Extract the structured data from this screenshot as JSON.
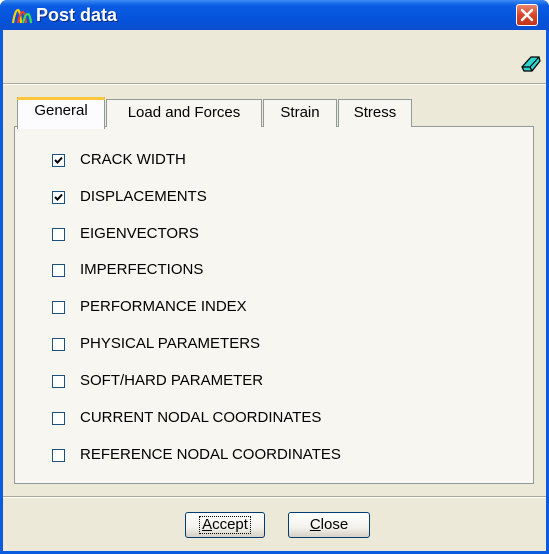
{
  "window": {
    "title": "Post data"
  },
  "toolbar": {
    "icon": "eraser-icon"
  },
  "tabs": [
    {
      "label": "General",
      "active": true
    },
    {
      "label": "Load and Forces",
      "active": false
    },
    {
      "label": "Strain",
      "active": false
    },
    {
      "label": "Stress",
      "active": false
    }
  ],
  "options": [
    {
      "label": "CRACK WIDTH",
      "checked": true
    },
    {
      "label": "DISPLACEMENTS",
      "checked": true
    },
    {
      "label": "EIGENVECTORS",
      "checked": false
    },
    {
      "label": "IMPERFECTIONS",
      "checked": false
    },
    {
      "label": "PERFORMANCE INDEX",
      "checked": false
    },
    {
      "label": "PHYSICAL PARAMETERS",
      "checked": false
    },
    {
      "label": "SOFT/HARD PARAMETER",
      "checked": false
    },
    {
      "label": "CURRENT NODAL COORDINATES",
      "checked": false
    },
    {
      "label": "REFERENCE NODAL COORDINATES",
      "checked": false
    }
  ],
  "buttons": {
    "accept": {
      "mnemonic": "A",
      "rest": "ccept"
    },
    "close": {
      "mnemonic": "C",
      "rest": "lose"
    }
  },
  "colors": {
    "titlebar": "#0553dc",
    "client": "#ece9d8",
    "tab_highlight": "#ffc83c",
    "close_button": "#d9452a"
  }
}
